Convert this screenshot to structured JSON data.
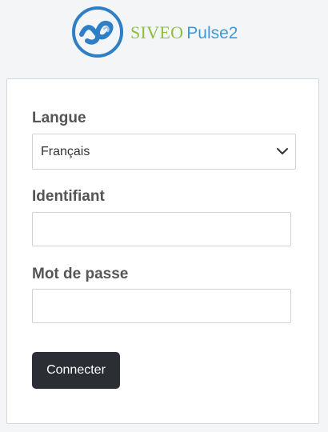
{
  "header": {
    "brand_part1": "SIVEO",
    "brand_part2": "Pulse2",
    "logo_icon": "siveo-logo-icon"
  },
  "form": {
    "language": {
      "label": "Langue",
      "selected": "Français",
      "icon": "chevron-down-icon"
    },
    "username": {
      "label": "Identifiant",
      "value": ""
    },
    "password": {
      "label": "Mot de passe",
      "value": ""
    },
    "submit_label": "Connecter"
  },
  "colors": {
    "page_background": "#f4f5f7",
    "brand_green": "#8dbf3f",
    "brand_blue": "#3d9ad8",
    "logo_blue": "#2f7fc7",
    "label_gray": "#555555",
    "button_dark": "#2b2f35"
  }
}
